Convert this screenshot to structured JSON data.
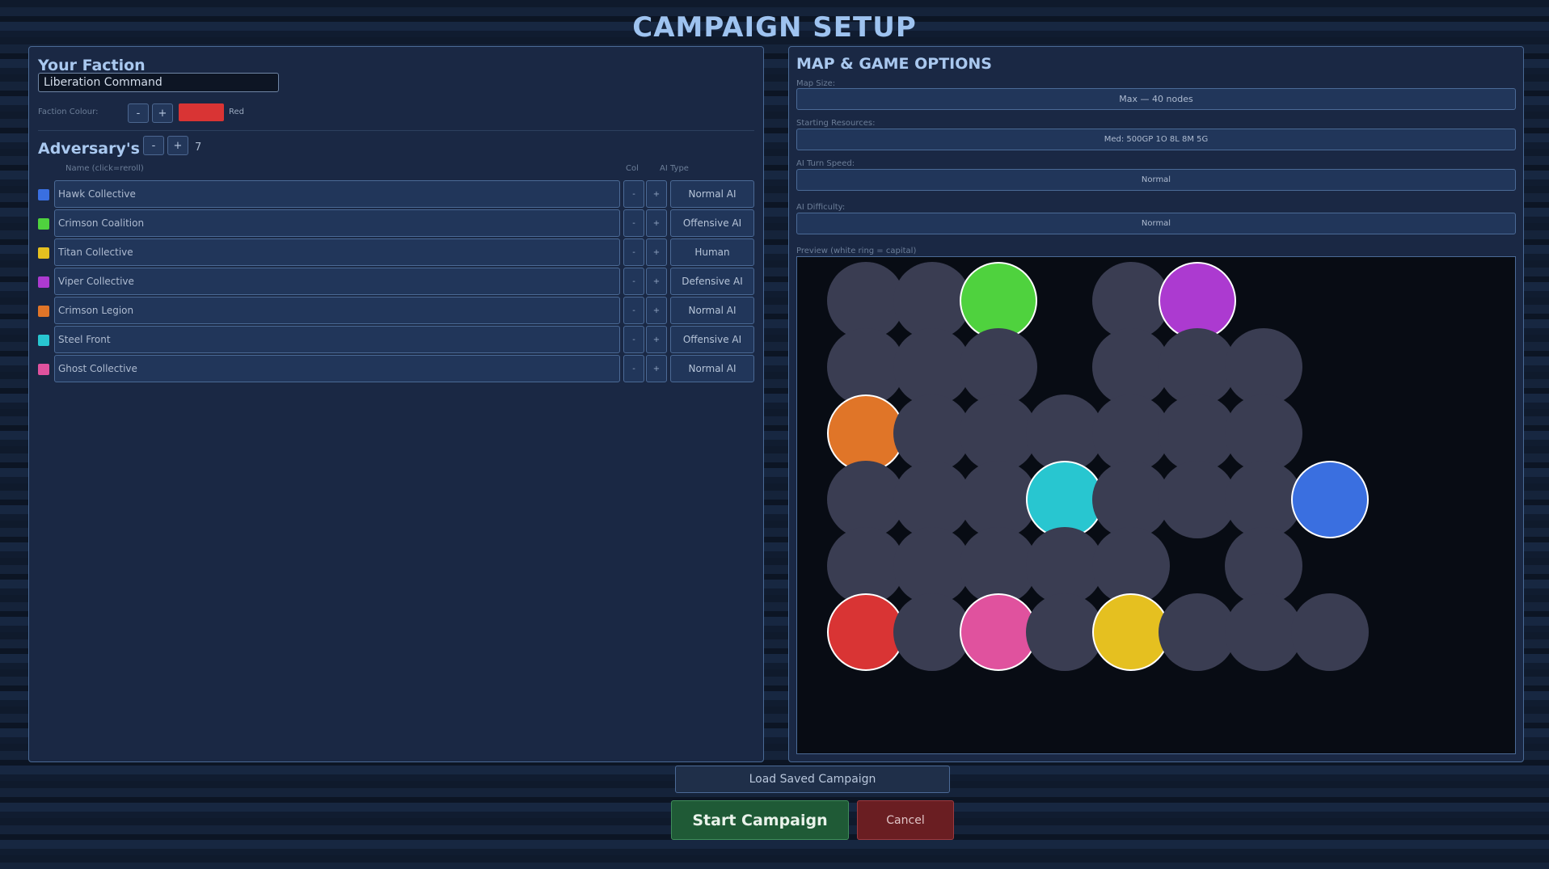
{
  "title": "CAMPAIGN SETUP",
  "faction": {
    "heading": "Your Faction",
    "name_value": "Liberation Command",
    "colour_label": "Faction Colour:",
    "minus": "-",
    "plus": "+",
    "colour_hex": "#d93434",
    "colour_name": "Red"
  },
  "adversaries": {
    "heading": "Adversary's",
    "minus": "-",
    "plus": "+",
    "count": "7",
    "col_name": "Name (click=reroll)",
    "col_col": "Col",
    "col_ai": "AI Type",
    "rows": [
      {
        "name": "Hawk Collective",
        "color": "#3a6fe0",
        "ai": "Normal AI",
        "minus": "-",
        "plus": "+"
      },
      {
        "name": "Crimson Coalition",
        "color": "#4fd23e",
        "ai": "Offensive AI",
        "minus": "-",
        "plus": "+"
      },
      {
        "name": "Titan Collective",
        "color": "#e5c020",
        "ai": "Human",
        "minus": "-",
        "plus": "+"
      },
      {
        "name": "Viper Collective",
        "color": "#ac3ad0",
        "ai": "Defensive AI",
        "minus": "-",
        "plus": "+"
      },
      {
        "name": "Crimson Legion",
        "color": "#e07528",
        "ai": "Normal AI",
        "minus": "-",
        "plus": "+"
      },
      {
        "name": "Steel Front",
        "color": "#28c6d0",
        "ai": "Offensive AI",
        "minus": "-",
        "plus": "+"
      },
      {
        "name": "Ghost Collective",
        "color": "#e0529e",
        "ai": "Normal AI",
        "minus": "-",
        "plus": "+"
      }
    ]
  },
  "options": {
    "heading": "MAP & GAME OPTIONS",
    "map_size_label": "Map Size:",
    "map_size_value": "Max — 40 nodes",
    "resources_label": "Starting Resources:",
    "resources_value": "Med: 500GP  1O  8L  8M  5G",
    "turn_speed_label": "AI Turn Speed:",
    "turn_speed_value": "Normal",
    "difficulty_label": "AI Difficulty:",
    "difficulty_value": "Normal",
    "preview_label": "Preview (white ring = capital)"
  },
  "map_preview": {
    "columns": 8,
    "rows": 6,
    "neutral_color": "#3a3d52",
    "nodes": [
      {
        "row": 0,
        "col": 0,
        "owner": null
      },
      {
        "row": 0,
        "col": 1,
        "owner": null
      },
      {
        "row": 0,
        "col": 2,
        "owner": "#4fd23e",
        "capital": true
      },
      {
        "row": 0,
        "col": 4,
        "owner": null
      },
      {
        "row": 0,
        "col": 5,
        "owner": "#ac3ad0",
        "capital": true
      },
      {
        "row": 1,
        "col": 0,
        "owner": null
      },
      {
        "row": 1,
        "col": 1,
        "owner": null
      },
      {
        "row": 1,
        "col": 2,
        "owner": null
      },
      {
        "row": 1,
        "col": 4,
        "owner": null
      },
      {
        "row": 1,
        "col": 5,
        "owner": null
      },
      {
        "row": 1,
        "col": 6,
        "owner": null
      },
      {
        "row": 2,
        "col": 0,
        "owner": "#e07528",
        "capital": true
      },
      {
        "row": 2,
        "col": 1,
        "owner": null
      },
      {
        "row": 2,
        "col": 2,
        "owner": null
      },
      {
        "row": 2,
        "col": 3,
        "owner": null
      },
      {
        "row": 2,
        "col": 4,
        "owner": null
      },
      {
        "row": 2,
        "col": 5,
        "owner": null
      },
      {
        "row": 2,
        "col": 6,
        "owner": null
      },
      {
        "row": 3,
        "col": 0,
        "owner": null
      },
      {
        "row": 3,
        "col": 1,
        "owner": null
      },
      {
        "row": 3,
        "col": 2,
        "owner": null
      },
      {
        "row": 3,
        "col": 3,
        "owner": "#28c6d0",
        "capital": true
      },
      {
        "row": 3,
        "col": 4,
        "owner": null
      },
      {
        "row": 3,
        "col": 5,
        "owner": null
      },
      {
        "row": 3,
        "col": 6,
        "owner": null
      },
      {
        "row": 3,
        "col": 7,
        "owner": "#3a6fe0",
        "capital": true
      },
      {
        "row": 4,
        "col": 0,
        "owner": null
      },
      {
        "row": 4,
        "col": 1,
        "owner": null
      },
      {
        "row": 4,
        "col": 2,
        "owner": null
      },
      {
        "row": 4,
        "col": 3,
        "owner": null
      },
      {
        "row": 4,
        "col": 4,
        "owner": null
      },
      {
        "row": 4,
        "col": 6,
        "owner": null
      },
      {
        "row": 5,
        "col": 0,
        "owner": "#d93434",
        "capital": true
      },
      {
        "row": 5,
        "col": 1,
        "owner": null
      },
      {
        "row": 5,
        "col": 2,
        "owner": "#e0529e",
        "capital": true
      },
      {
        "row": 5,
        "col": 3,
        "owner": null
      },
      {
        "row": 5,
        "col": 4,
        "owner": "#e5c020",
        "capital": true
      },
      {
        "row": 5,
        "col": 5,
        "owner": null
      },
      {
        "row": 5,
        "col": 6,
        "owner": null
      },
      {
        "row": 5,
        "col": 7,
        "owner": null
      }
    ]
  },
  "buttons": {
    "load": "Load Saved Campaign",
    "start": "Start Campaign",
    "cancel": "Cancel"
  }
}
